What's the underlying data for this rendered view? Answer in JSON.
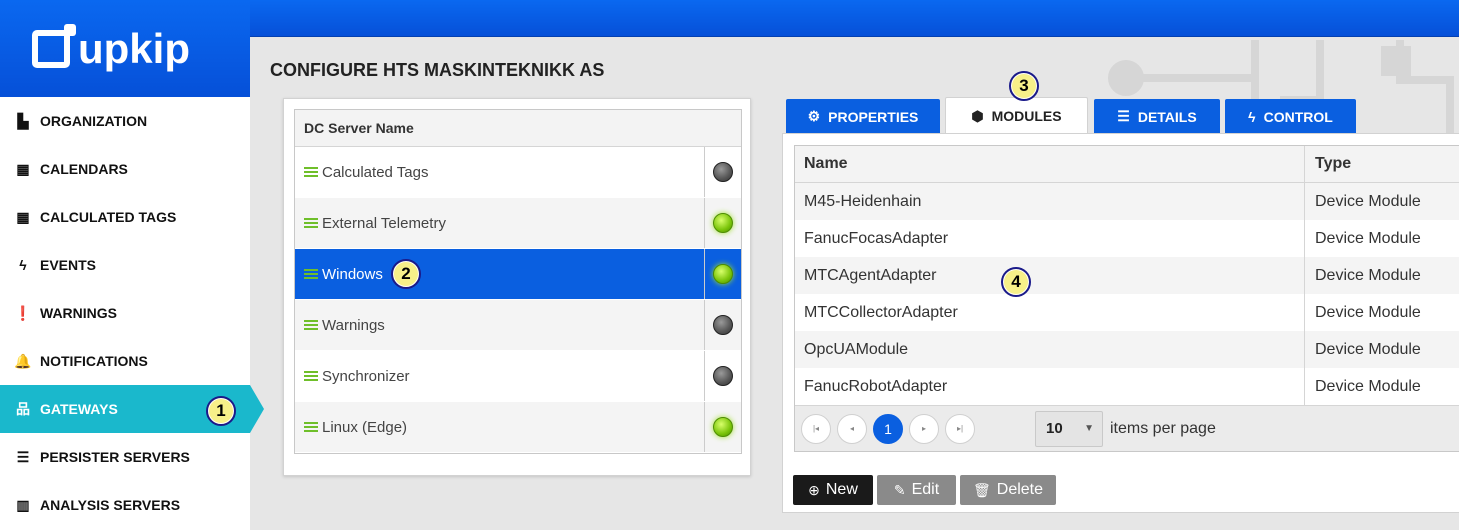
{
  "brand": {
    "name": "upkip"
  },
  "sidebar": {
    "items": [
      {
        "label": "ORGANIZATION",
        "icon": "area-chart-icon",
        "glyph": "▙"
      },
      {
        "label": "CALENDARS",
        "icon": "calendar-icon",
        "glyph": "▦"
      },
      {
        "label": "CALCULATED TAGS",
        "icon": "calculator-icon",
        "glyph": "▦"
      },
      {
        "label": "EVENTS",
        "icon": "lightning-icon",
        "glyph": "ϟ"
      },
      {
        "label": "WARNINGS",
        "icon": "exclamation-icon",
        "glyph": "❗"
      },
      {
        "label": "NOTIFICATIONS",
        "icon": "bell-icon",
        "glyph": "🔔"
      },
      {
        "label": "GATEWAYS",
        "icon": "sitemap-icon",
        "glyph": "品"
      },
      {
        "label": "PERSISTER SERVERS",
        "icon": "server-icon",
        "glyph": "☰"
      },
      {
        "label": "ANALYSIS SERVERS",
        "icon": "bar-chart-icon",
        "glyph": "▥"
      }
    ],
    "active_index": 6
  },
  "header": {
    "title_bold": "CONFIGURE",
    "title_rest": "HTS MASKINTEKNIKK AS"
  },
  "badges": [
    "1",
    "2",
    "3",
    "4"
  ],
  "servers": {
    "column": "DC Server Name",
    "rows": [
      {
        "name": "Calculated Tags",
        "online": false
      },
      {
        "name": "External Telemetry",
        "online": true
      },
      {
        "name": "Windows",
        "online": true,
        "selected": true
      },
      {
        "name": "Warnings",
        "online": false
      },
      {
        "name": "Synchronizer",
        "online": false
      },
      {
        "name": "Linux (Edge)",
        "online": true
      }
    ]
  },
  "tabs": [
    {
      "label": "PROPERTIES",
      "icon": "gear-icon",
      "glyph": "⚙"
    },
    {
      "label": "MODULES",
      "icon": "cubes-icon",
      "glyph": "⬢",
      "active": true
    },
    {
      "label": "DETAILS",
      "icon": "list-icon",
      "glyph": "☰"
    },
    {
      "label": "CONTROL",
      "icon": "bolt-icon",
      "glyph": "ϟ"
    }
  ],
  "modules": {
    "columns": {
      "name": "Name",
      "type": "Type"
    },
    "rows": [
      {
        "name": "M45-Heidenhain",
        "type": "Device Module"
      },
      {
        "name": "FanucFocasAdapter",
        "type": "Device Module"
      },
      {
        "name": "MTCAgentAdapter",
        "type": "Device Module"
      },
      {
        "name": "MTCCollectorAdapter",
        "type": "Device Module"
      },
      {
        "name": "OpcUAModule",
        "type": "Device Module"
      },
      {
        "name": "FanucRobotAdapter",
        "type": "Device Module"
      }
    ],
    "pager": {
      "first": "|◂",
      "prev": "◂",
      "current_page": "1",
      "next": "▸",
      "last": "▸|",
      "page_size": "10",
      "page_size_label": "items per page"
    }
  },
  "actions": {
    "new": {
      "label": "New",
      "glyph": "⊕"
    },
    "edit": {
      "label": "Edit",
      "glyph": "✎"
    },
    "delete": {
      "label": "Delete",
      "glyph": "🗑"
    }
  },
  "colors": {
    "brand_blue": "#0a5fe0",
    "active_nav": "#1ab8cc",
    "online": "#7ac40a"
  }
}
